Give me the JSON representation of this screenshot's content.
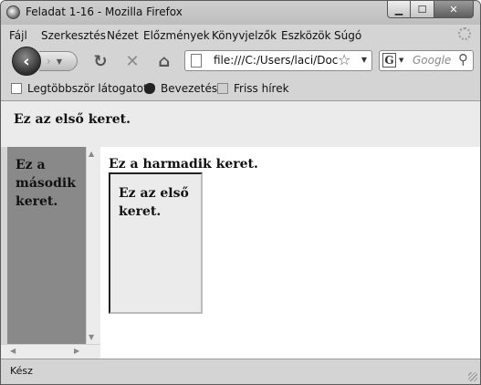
{
  "window": {
    "title": "Feladat 1-16 - Mozilla Firefox",
    "controls": {
      "minimize": "▁",
      "maximize": "☐",
      "close": "✕"
    }
  },
  "menu": [
    "Fájl",
    "Szerkesztés",
    "Nézet",
    "Előzmények",
    "Könyvjelzők",
    "Eszközök",
    "Súgó"
  ],
  "navbar": {
    "back_icon": "‹",
    "forward_icon": "›",
    "reload_icon": "↻",
    "stop_icon": "✕",
    "home_icon": "⌂",
    "url": "file:///C:/Users/laci/Doc",
    "star_icon": "☆",
    "search_engine": "G",
    "search_placeholder": "Google",
    "search_icon": "⚲"
  },
  "bookmarks": [
    "Legtöbbször látogatott",
    "Bevezetés",
    "Friss hírek"
  ],
  "content": {
    "frame1_text": "Ez az első keret.",
    "frame2_text": "Ez a második keret.",
    "frame3_heading": "Ez a harmadik keret.",
    "iframe_text": "Ez az első keret."
  },
  "scrollbar_arrows": {
    "up": "▲",
    "down": "▼",
    "left": "◀",
    "right": "▶"
  },
  "status": "Kész",
  "colors": {
    "frame1_bg": "#ebebeb",
    "frame2_bg": "#898989",
    "frame3_bg": "#ffffff"
  }
}
